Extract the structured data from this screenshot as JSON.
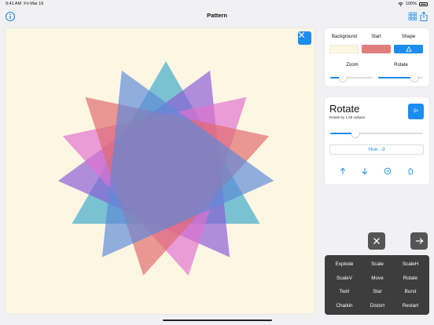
{
  "status_bar": {
    "time": "9:41 AM",
    "date": "Fri Mar 19",
    "battery": "100%"
  },
  "navbar": {
    "title": "Pattern"
  },
  "canvas": {
    "background": "#fdf6e3",
    "shape_colors": [
      "#3ba9c9",
      "#8b5cd6",
      "#df72cf",
      "#e06a6a",
      "#5b8bd8"
    ]
  },
  "settings": {
    "background_label": "Background",
    "start_label": "Start",
    "shape_label": "Shape",
    "zoom_label": "Zoom",
    "rotate_label": "Rotate",
    "background_color": "#fdf6e3",
    "start_color": "#e07d7d",
    "shape_color": "#1b8cf0",
    "zoom_value": 0.3,
    "rotate_value": 0.8
  },
  "rotate_panel": {
    "title": "Rotate",
    "subtitle": "Rotate by 1.58 radians",
    "multiplier": "3×",
    "slider_value": 0.27,
    "hue": "Hue: -3"
  },
  "menu": {
    "items": [
      "Explode",
      "Scale",
      "ScaleH",
      "ScaleV",
      "Move",
      "Rotate",
      "Twirl",
      "Star",
      "Burst",
      "Chaikin",
      "Distort",
      "Restart"
    ]
  },
  "icons": {
    "info": "info-icon",
    "grid": "grid-icon",
    "share": "share-icon",
    "close": "close-icon",
    "arrow_right": "arrow-right-icon",
    "arrow_up": "arrow-up-icon",
    "arrow_down": "arrow-down-icon",
    "minus_circle": "minus-circle-icon",
    "hand": "hand-icon",
    "triangle": "triangle-icon"
  }
}
